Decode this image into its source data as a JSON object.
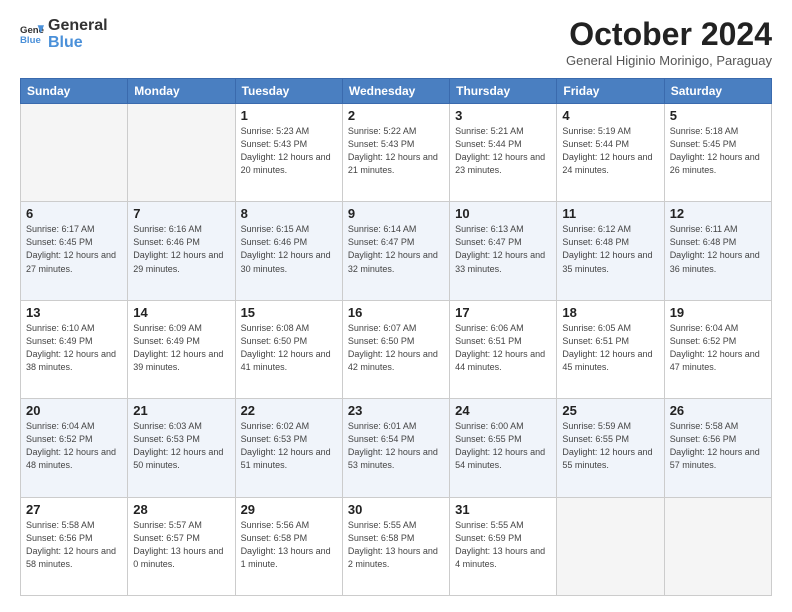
{
  "header": {
    "logo_general": "General",
    "logo_blue": "Blue",
    "month_title": "October 2024",
    "subtitle": "General Higinio Morinigo, Paraguay"
  },
  "days_of_week": [
    "Sunday",
    "Monday",
    "Tuesday",
    "Wednesday",
    "Thursday",
    "Friday",
    "Saturday"
  ],
  "weeks": [
    [
      {
        "day": "",
        "info": ""
      },
      {
        "day": "",
        "info": ""
      },
      {
        "day": "1",
        "info": "Sunrise: 5:23 AM\nSunset: 5:43 PM\nDaylight: 12 hours and 20 minutes."
      },
      {
        "day": "2",
        "info": "Sunrise: 5:22 AM\nSunset: 5:43 PM\nDaylight: 12 hours and 21 minutes."
      },
      {
        "day": "3",
        "info": "Sunrise: 5:21 AM\nSunset: 5:44 PM\nDaylight: 12 hours and 23 minutes."
      },
      {
        "day": "4",
        "info": "Sunrise: 5:19 AM\nSunset: 5:44 PM\nDaylight: 12 hours and 24 minutes."
      },
      {
        "day": "5",
        "info": "Sunrise: 5:18 AM\nSunset: 5:45 PM\nDaylight: 12 hours and 26 minutes."
      }
    ],
    [
      {
        "day": "6",
        "info": "Sunrise: 6:17 AM\nSunset: 6:45 PM\nDaylight: 12 hours and 27 minutes."
      },
      {
        "day": "7",
        "info": "Sunrise: 6:16 AM\nSunset: 6:46 PM\nDaylight: 12 hours and 29 minutes."
      },
      {
        "day": "8",
        "info": "Sunrise: 6:15 AM\nSunset: 6:46 PM\nDaylight: 12 hours and 30 minutes."
      },
      {
        "day": "9",
        "info": "Sunrise: 6:14 AM\nSunset: 6:47 PM\nDaylight: 12 hours and 32 minutes."
      },
      {
        "day": "10",
        "info": "Sunrise: 6:13 AM\nSunset: 6:47 PM\nDaylight: 12 hours and 33 minutes."
      },
      {
        "day": "11",
        "info": "Sunrise: 6:12 AM\nSunset: 6:48 PM\nDaylight: 12 hours and 35 minutes."
      },
      {
        "day": "12",
        "info": "Sunrise: 6:11 AM\nSunset: 6:48 PM\nDaylight: 12 hours and 36 minutes."
      }
    ],
    [
      {
        "day": "13",
        "info": "Sunrise: 6:10 AM\nSunset: 6:49 PM\nDaylight: 12 hours and 38 minutes."
      },
      {
        "day": "14",
        "info": "Sunrise: 6:09 AM\nSunset: 6:49 PM\nDaylight: 12 hours and 39 minutes."
      },
      {
        "day": "15",
        "info": "Sunrise: 6:08 AM\nSunset: 6:50 PM\nDaylight: 12 hours and 41 minutes."
      },
      {
        "day": "16",
        "info": "Sunrise: 6:07 AM\nSunset: 6:50 PM\nDaylight: 12 hours and 42 minutes."
      },
      {
        "day": "17",
        "info": "Sunrise: 6:06 AM\nSunset: 6:51 PM\nDaylight: 12 hours and 44 minutes."
      },
      {
        "day": "18",
        "info": "Sunrise: 6:05 AM\nSunset: 6:51 PM\nDaylight: 12 hours and 45 minutes."
      },
      {
        "day": "19",
        "info": "Sunrise: 6:04 AM\nSunset: 6:52 PM\nDaylight: 12 hours and 47 minutes."
      }
    ],
    [
      {
        "day": "20",
        "info": "Sunrise: 6:04 AM\nSunset: 6:52 PM\nDaylight: 12 hours and 48 minutes."
      },
      {
        "day": "21",
        "info": "Sunrise: 6:03 AM\nSunset: 6:53 PM\nDaylight: 12 hours and 50 minutes."
      },
      {
        "day": "22",
        "info": "Sunrise: 6:02 AM\nSunset: 6:53 PM\nDaylight: 12 hours and 51 minutes."
      },
      {
        "day": "23",
        "info": "Sunrise: 6:01 AM\nSunset: 6:54 PM\nDaylight: 12 hours and 53 minutes."
      },
      {
        "day": "24",
        "info": "Sunrise: 6:00 AM\nSunset: 6:55 PM\nDaylight: 12 hours and 54 minutes."
      },
      {
        "day": "25",
        "info": "Sunrise: 5:59 AM\nSunset: 6:55 PM\nDaylight: 12 hours and 55 minutes."
      },
      {
        "day": "26",
        "info": "Sunrise: 5:58 AM\nSunset: 6:56 PM\nDaylight: 12 hours and 57 minutes."
      }
    ],
    [
      {
        "day": "27",
        "info": "Sunrise: 5:58 AM\nSunset: 6:56 PM\nDaylight: 12 hours and 58 minutes."
      },
      {
        "day": "28",
        "info": "Sunrise: 5:57 AM\nSunset: 6:57 PM\nDaylight: 13 hours and 0 minutes."
      },
      {
        "day": "29",
        "info": "Sunrise: 5:56 AM\nSunset: 6:58 PM\nDaylight: 13 hours and 1 minute."
      },
      {
        "day": "30",
        "info": "Sunrise: 5:55 AM\nSunset: 6:58 PM\nDaylight: 13 hours and 2 minutes."
      },
      {
        "day": "31",
        "info": "Sunrise: 5:55 AM\nSunset: 6:59 PM\nDaylight: 13 hours and 4 minutes."
      },
      {
        "day": "",
        "info": ""
      },
      {
        "day": "",
        "info": ""
      }
    ]
  ]
}
